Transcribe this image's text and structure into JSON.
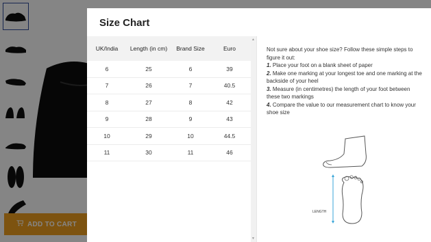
{
  "background": {
    "add_to_cart_label": "ADD TO CART",
    "thumbnails": [
      "shoe-side",
      "shoe-side",
      "shoe-side",
      "shoe-pair",
      "shoe-side",
      "shoe-soles",
      "shoe-top"
    ]
  },
  "modal": {
    "title": "Size Chart",
    "table": {
      "headers": [
        "UK/India",
        "Length (in cm)",
        "Brand Size",
        "Euro"
      ],
      "rows": [
        [
          "6",
          "25",
          "6",
          "39"
        ],
        [
          "7",
          "26",
          "7",
          "40.5"
        ],
        [
          "8",
          "27",
          "8",
          "42"
        ],
        [
          "9",
          "28",
          "9",
          "43"
        ],
        [
          "10",
          "29",
          "10",
          "44.5"
        ],
        [
          "11",
          "30",
          "11",
          "46"
        ]
      ]
    },
    "guide": {
      "intro": "Not sure about your shoe size? Follow these simple steps to figure it out:",
      "steps": [
        {
          "num": "1.",
          "text": " Place your foot on a blank sheet of paper"
        },
        {
          "num": "2.",
          "text": " Make one marking at your longest toe and one marking at the backside of your heel"
        },
        {
          "num": "3.",
          "text": " Measure (in centimetres) the length of your foot between these two markings"
        },
        {
          "num": "4.",
          "text": " Compare the value to our measurement chart to know your shoe size"
        }
      ],
      "illustration_label": "LENGTH"
    }
  },
  "colors": {
    "cart_button": "#f0a020",
    "overlay": "rgba(0,0,0,0.48)",
    "measure_line": "#3aa6d8"
  }
}
